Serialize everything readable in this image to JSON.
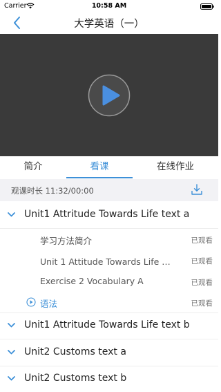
{
  "status_bar": {
    "carrier": "Carrier",
    "time": "10:58 AM"
  },
  "nav": {
    "title": "大学英语（一）"
  },
  "tabs": [
    {
      "label": "简介"
    },
    {
      "label": "看课"
    },
    {
      "label": "在线作业"
    }
  ],
  "active_tab": "看课",
  "watch_info": {
    "duration": "观课时长 11:32/00:00"
  },
  "colors": {
    "accent": "#3d90d8",
    "video_bg": "#3a3a3a",
    "info_bg": "#f2f2f5"
  },
  "units": [
    {
      "title": "Unit1 Attritude Towards Life text a",
      "expanded": true,
      "lessons": [
        {
          "title": "学习方法简介",
          "status": "已观看"
        },
        {
          "title": "Unit 1 Attitude Towards Life 第…",
          "status": "已观看"
        },
        {
          "title": "Exercise 2 Vocabulary A",
          "status": "已观看"
        },
        {
          "title": "语法",
          "status": "已观看",
          "playing": true
        }
      ]
    },
    {
      "title": "Unit1 Attritude Towards Life text b",
      "expanded": false
    },
    {
      "title": "Unit2 Customs text a",
      "expanded": false
    },
    {
      "title": "Unit2 Customs text b",
      "expanded": false
    }
  ]
}
